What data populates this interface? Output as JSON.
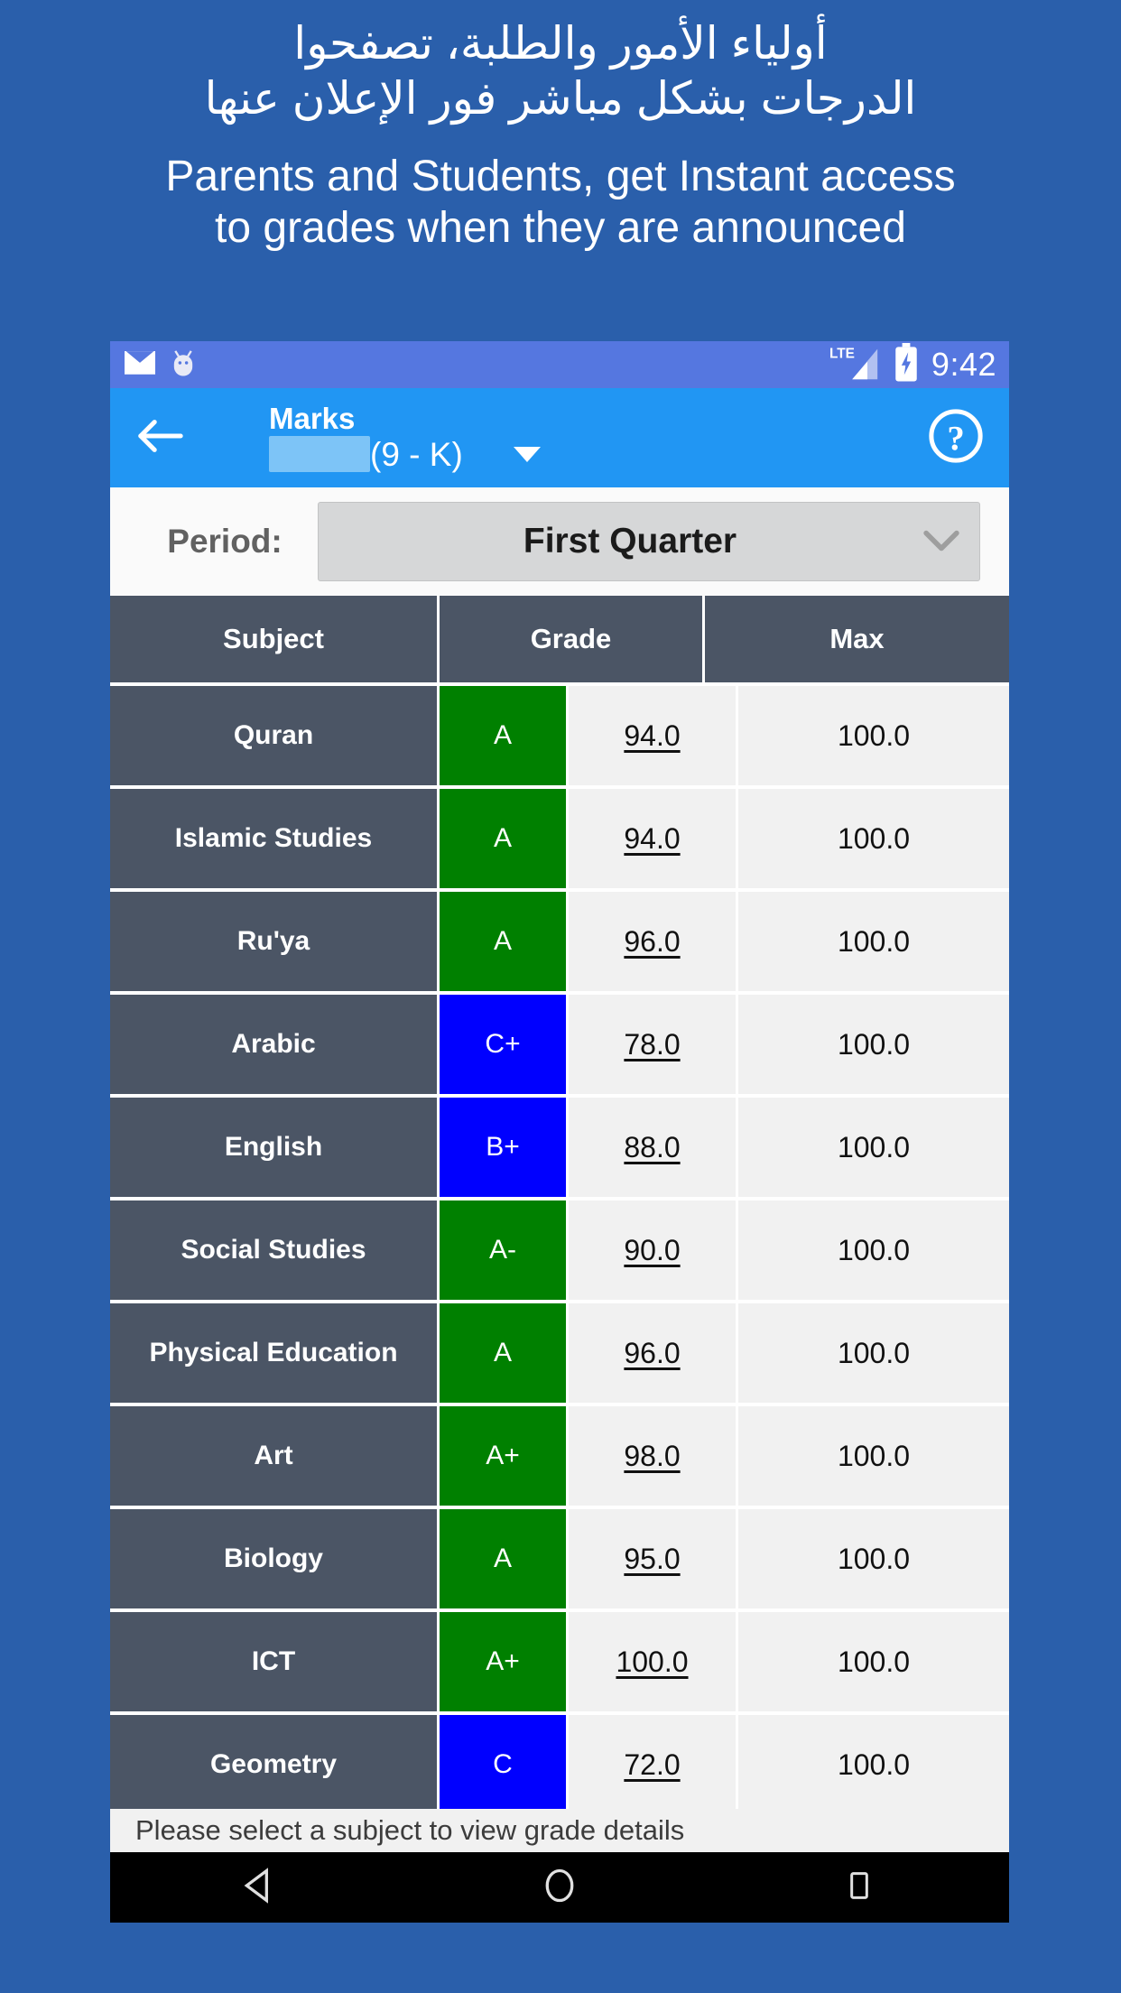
{
  "promo": {
    "arabic_lines": [
      "أولياء الأمور والطلبة، تصفحوا",
      "الدرجات بشكل مباشر فور الإعلان عنها"
    ],
    "english_lines": [
      "Parents and Students, get Instant access",
      "to grades when they are announced"
    ],
    "background_color": "#2a5fab"
  },
  "statusbar": {
    "icons": [
      "email-icon",
      "android-head-icon"
    ],
    "lte_label": "LTE",
    "signal_icon": "signal-bars-icon",
    "battery_icon": "battery-charging-icon",
    "time": "9:42",
    "background_color": "#5577e0"
  },
  "appbar": {
    "back_icon": "arrow-left-icon",
    "title": "Marks",
    "student_name_redacted": "",
    "student_class": "(9 - K)",
    "dropdown_icon": "caret-down-icon",
    "help_icon": "help-circle-icon",
    "background_color": "#2196f3"
  },
  "period": {
    "label": "Period:",
    "selected": "First Quarter",
    "chevron_icon": "chevron-down-icon",
    "options": [
      "First Quarter"
    ]
  },
  "table": {
    "columns": [
      "Subject",
      "Grade",
      "Max"
    ],
    "grade_colors": {
      "green": "#008000",
      "blue": "#0000ff"
    },
    "rows": [
      {
        "subject": "Quran",
        "grade": "A",
        "grade_color": "green",
        "mark": "94.0",
        "max": "100.0"
      },
      {
        "subject": "Islamic Studies",
        "grade": "A",
        "grade_color": "green",
        "mark": "94.0",
        "max": "100.0"
      },
      {
        "subject": "Ru'ya",
        "grade": "A",
        "grade_color": "green",
        "mark": "96.0",
        "max": "100.0"
      },
      {
        "subject": "Arabic",
        "grade": "C+",
        "grade_color": "blue",
        "mark": "78.0",
        "max": "100.0"
      },
      {
        "subject": "English",
        "grade": "B+",
        "grade_color": "blue",
        "mark": "88.0",
        "max": "100.0"
      },
      {
        "subject": "Social Studies",
        "grade": "A-",
        "grade_color": "green",
        "mark": "90.0",
        "max": "100.0"
      },
      {
        "subject": "Physical Education",
        "grade": "A",
        "grade_color": "green",
        "mark": "96.0",
        "max": "100.0"
      },
      {
        "subject": "Art",
        "grade": "A+",
        "grade_color": "green",
        "mark": "98.0",
        "max": "100.0"
      },
      {
        "subject": "Biology",
        "grade": "A",
        "grade_color": "green",
        "mark": "95.0",
        "max": "100.0"
      },
      {
        "subject": "ICT",
        "grade": "A+",
        "grade_color": "green",
        "mark": "100.0",
        "max": "100.0"
      },
      {
        "subject": "Geometry",
        "grade": "C",
        "grade_color": "blue",
        "mark": "72.0",
        "max": "100.0"
      }
    ]
  },
  "toast": {
    "message": "Please select a subject to view grade details"
  },
  "navbar": {
    "buttons": [
      "back-triangle-icon",
      "home-circle-icon",
      "recents-square-icon"
    ]
  }
}
